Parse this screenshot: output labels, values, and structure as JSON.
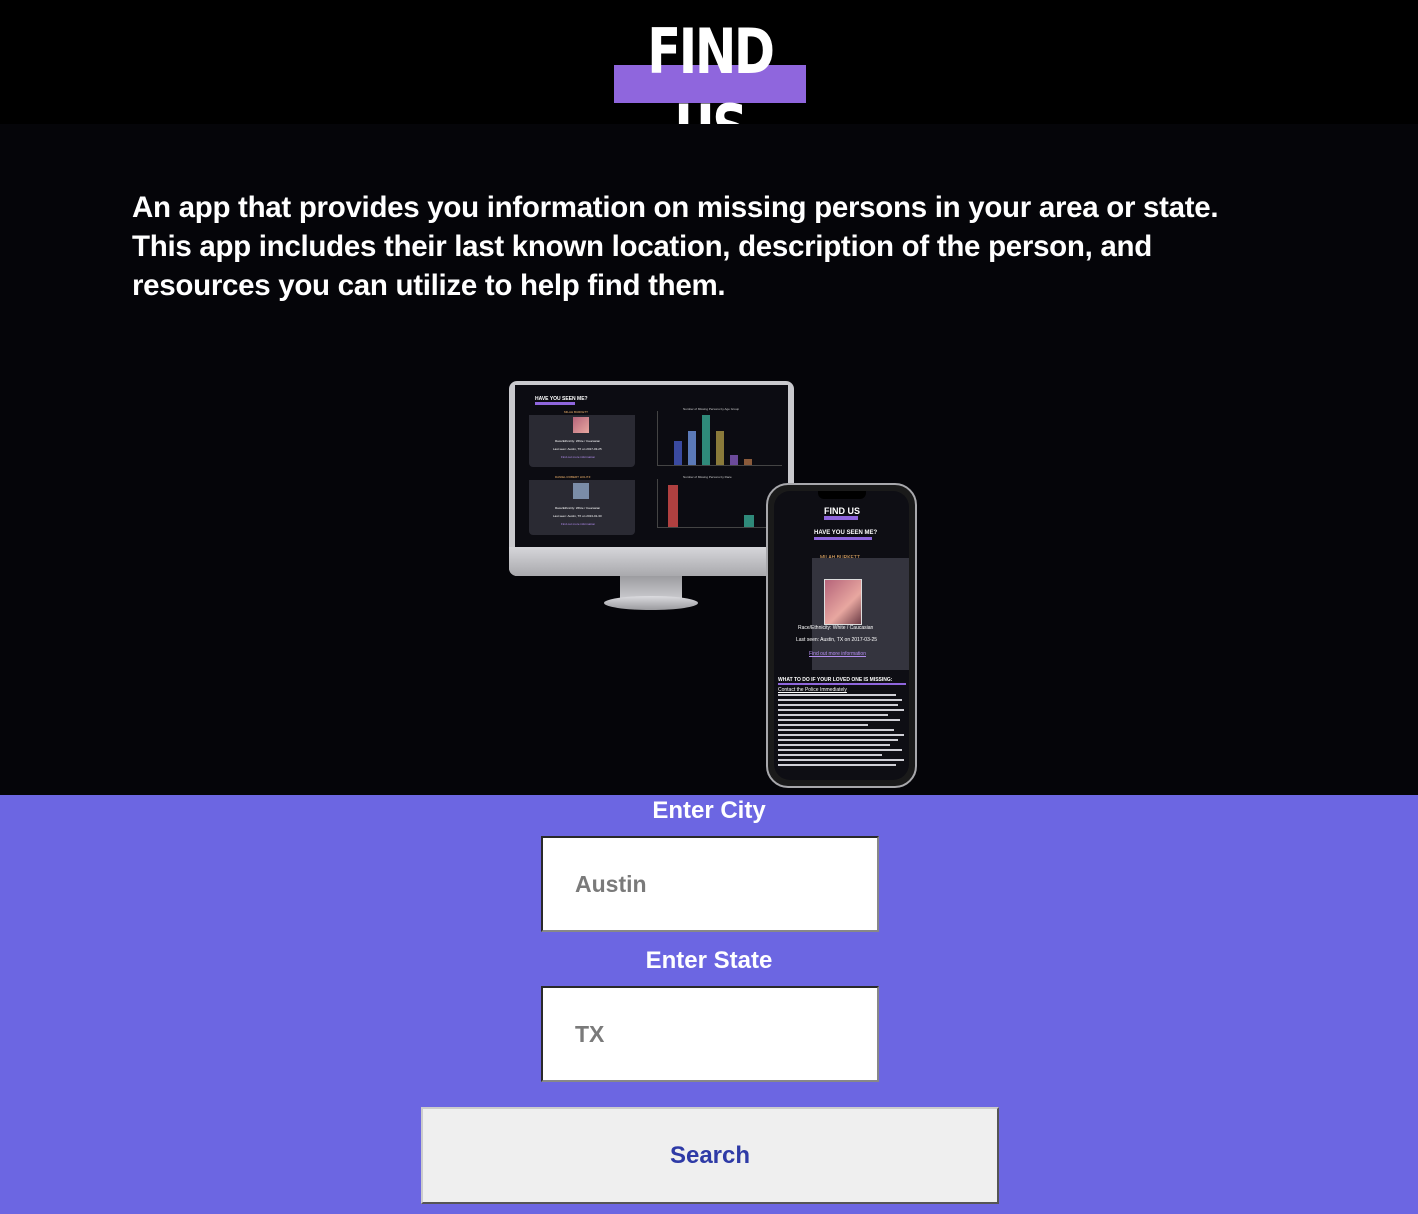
{
  "header": {
    "title": "FIND US"
  },
  "intro": {
    "description": "An app that provides you information on missing persons in your area or state. This app includes their last known location, description of the person, and resources you can utilize to help find them."
  },
  "mockup": {
    "desktop": {
      "heading": "HAVE YOU SEEN ME?",
      "person1_name": "MILAH BURKETT",
      "person1_race": "Race/Ethnicity: White / Caucasian",
      "person1_seen": "Last seen: Austin, TX on 2017-03-25",
      "person1_link": "Find out more information",
      "person2_name": "DANIEL ROBERT HOLITZ",
      "person2_race": "Race/Ethnicity: White / Caucasian",
      "person2_seen": "Last seen: Austin, TX on 2013-01-30",
      "person2_link": "Find out more information",
      "chart1_title": "Number of Missing Persons by Age Group",
      "chart2_title": "Number of Missing Persons by Race"
    },
    "phone": {
      "title": "FIND US",
      "heading": "HAVE YOU SEEN ME?",
      "person_name": "MILAH BURKETT",
      "race": "Race/Ethnicity: White / Caucasian",
      "last_seen": "Last seen: Austin, TX on 2017-03-25",
      "link": "Find out more information",
      "section_heading": "WHAT TO DO IF YOUR LOVED ONE IS MISSING:",
      "section_subheading": "Contact the Police Immediately"
    }
  },
  "form": {
    "city_label": "Enter City",
    "city_placeholder": "Austin",
    "state_label": "Enter State",
    "state_placeholder": "TX",
    "search_label": "Search"
  },
  "colors": {
    "accent": "#8f66dd",
    "form_bg": "#6c66e2",
    "button_text": "#2e3aa6"
  }
}
